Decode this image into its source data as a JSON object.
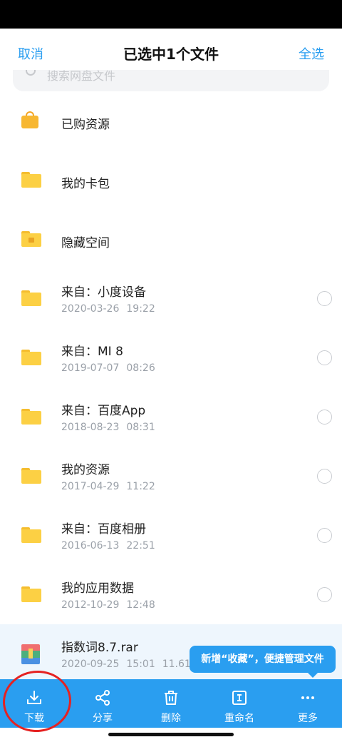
{
  "header": {
    "cancel_label": "取消",
    "title": "已选中1个文件",
    "select_all_label": "全选"
  },
  "search": {
    "placeholder": "搜索网盘文件"
  },
  "files": [
    {
      "name": "已购资源",
      "icon": "shopping-bag-icon"
    },
    {
      "name": "我的卡包",
      "icon": "folder-icon"
    },
    {
      "name": "隐藏空间",
      "icon": "locked-folder-icon"
    },
    {
      "name": "来自：小度设备",
      "date": "2020-03-26",
      "time": "19:22",
      "icon": "folder-icon"
    },
    {
      "name": "来自：MI 8",
      "date": "2019-07-07",
      "time": "08:26",
      "icon": "folder-icon"
    },
    {
      "name": "来自：百度App",
      "date": "2018-08-23",
      "time": "08:31",
      "icon": "folder-icon"
    },
    {
      "name": "我的资源",
      "date": "2017-04-29",
      "time": "11:22",
      "icon": "folder-icon"
    },
    {
      "name": "来自：百度相册",
      "date": "2016-06-13",
      "time": "22:51",
      "icon": "folder-icon"
    },
    {
      "name": "我的应用数据",
      "date": "2012-10-29",
      "time": "12:48",
      "icon": "folder-icon"
    },
    {
      "name": "指数词8.7.rar",
      "date": "2020-09-25",
      "time": "15:01",
      "size": "11.61K",
      "icon": "rar-archive-icon"
    }
  ],
  "tooltip": {
    "text": "新增“收藏”，便捷管理文件"
  },
  "toolbar": {
    "items": [
      {
        "label": "下载",
        "icon": "download-icon"
      },
      {
        "label": "分享",
        "icon": "share-icon"
      },
      {
        "label": "删除",
        "icon": "trash-icon"
      },
      {
        "label": "重命名",
        "icon": "rename-icon"
      },
      {
        "label": "更多",
        "icon": "more-icon"
      }
    ]
  },
  "colors": {
    "accent": "#2a9ef0",
    "folder": "#fcd044",
    "annotation": "#e52222"
  }
}
